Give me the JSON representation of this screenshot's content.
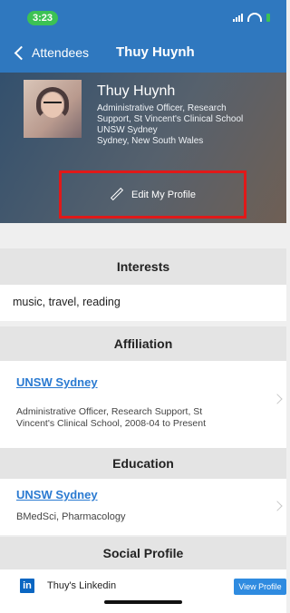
{
  "status_bar": {
    "time": "3:23",
    "icons": [
      "signal-icon",
      "wifi-icon",
      "battery-icon"
    ]
  },
  "nav": {
    "back_label": "Attendees",
    "title": "Thuy Huynh"
  },
  "profile": {
    "name": "Thuy Huynh",
    "lines": [
      "Administrative Officer, Research",
      "Support, St Vincent's Clinical School",
      "UNSW Sydney",
      "Sydney, New South Wales"
    ]
  },
  "edit_button": {
    "label": "Edit My Profile",
    "icon": "pencil-icon",
    "highlight_color": "#e01919"
  },
  "interests": {
    "header": "Interests",
    "text": "music, travel, reading"
  },
  "affiliation": {
    "header": "Affiliation",
    "org": "UNSW Sydney",
    "detail_lines": [
      "Administrative Officer, Research Support, St",
      "Vincent's Clinical School, 2008-04 to Present"
    ]
  },
  "education": {
    "header": "Education",
    "org": "UNSW Sydney",
    "detail": "BMedSci, Pharmacology"
  },
  "social": {
    "header": "Social Profile",
    "linkedin_label": "Thuy's Linkedin",
    "view_button": "View Profile"
  },
  "colors": {
    "nav_blue": "#2f78bf",
    "link_blue": "#2a7ad1",
    "time_green": "#3cc254"
  }
}
